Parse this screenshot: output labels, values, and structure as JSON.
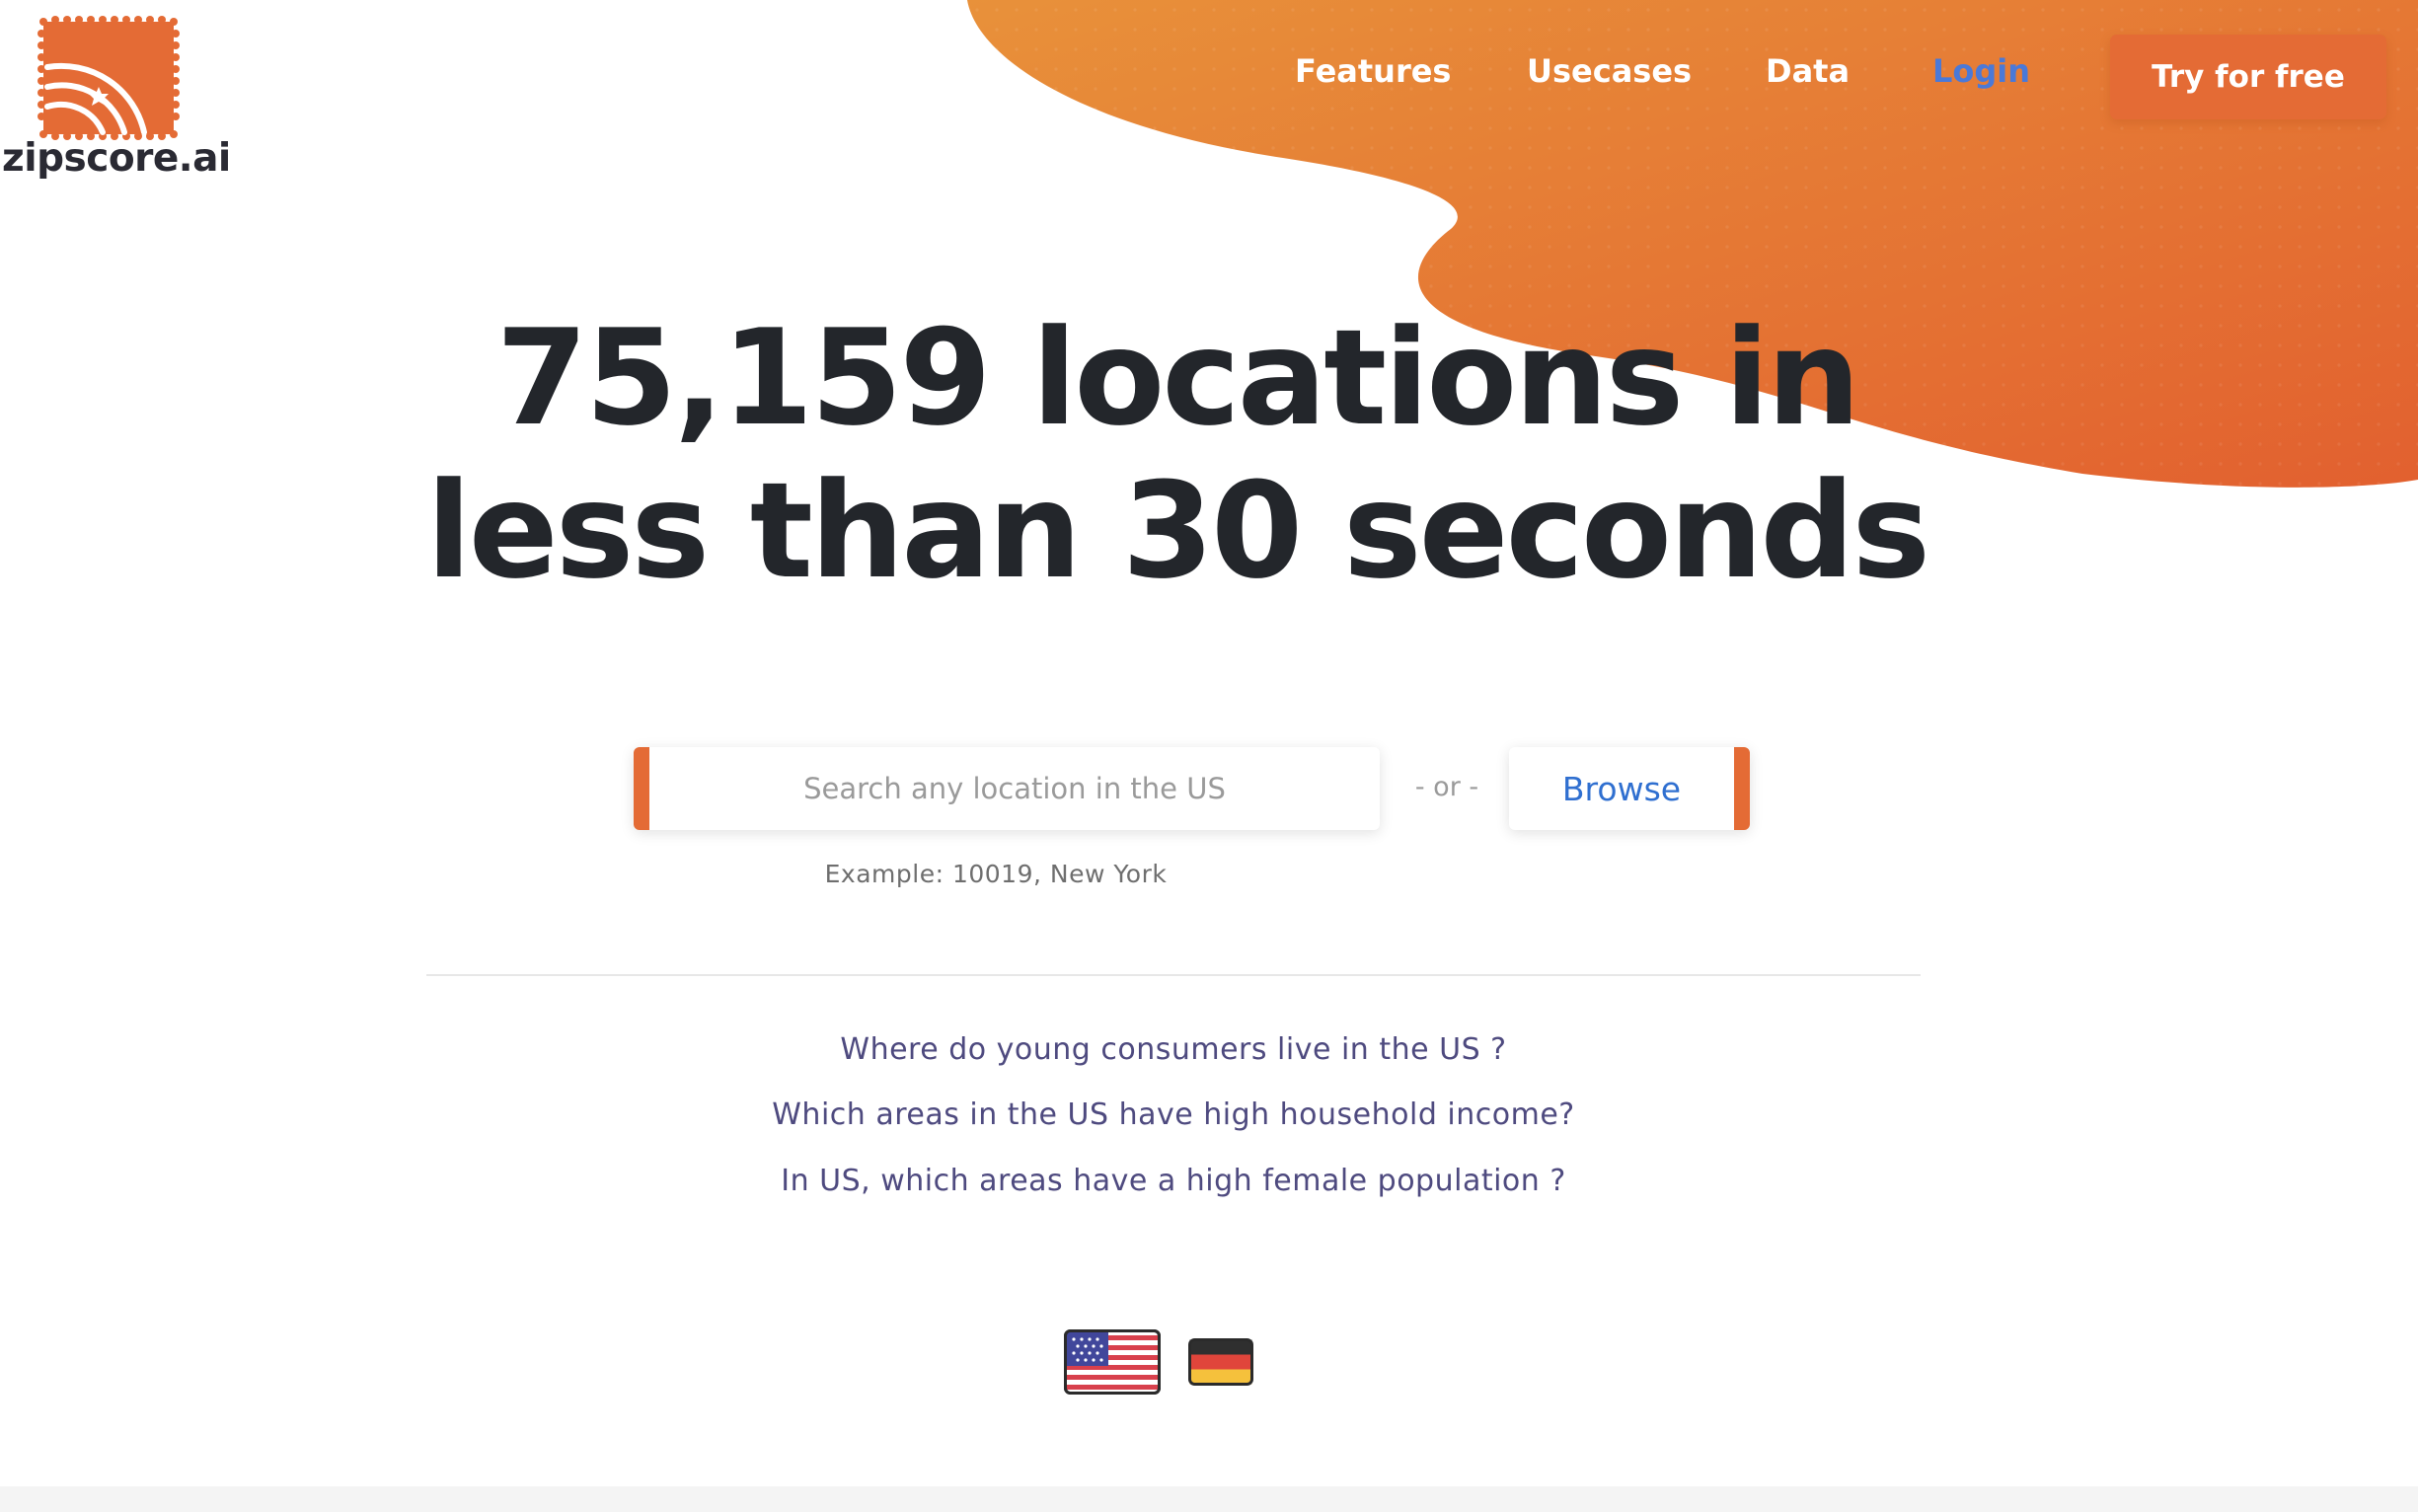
{
  "brand": {
    "name": "zipscore.ai",
    "accent_color": "#e46b35",
    "blob_gradient": [
      "#e8913a",
      "#e2602f"
    ]
  },
  "nav": {
    "items": [
      "Features",
      "Usecases",
      "Data"
    ],
    "login_label": "Login",
    "login_color": "#4a79d8",
    "cta_label": "Try for free"
  },
  "hero": {
    "line1": "75,159 locations in",
    "line2": "less than 30 seconds"
  },
  "search": {
    "placeholder": "Search any location in the US",
    "value": "",
    "separator": "- or -",
    "browse_label": "Browse",
    "example_text": "Example: 10019, New York"
  },
  "questions": [
    "Where do young consumers live in the US ?",
    "Which areas in the US have high household income?",
    "In US, which areas have a high female population ?"
  ],
  "flags": [
    {
      "country": "US",
      "icon": "us-flag-icon"
    },
    {
      "country": "DE",
      "icon": "germany-flag-icon"
    }
  ]
}
